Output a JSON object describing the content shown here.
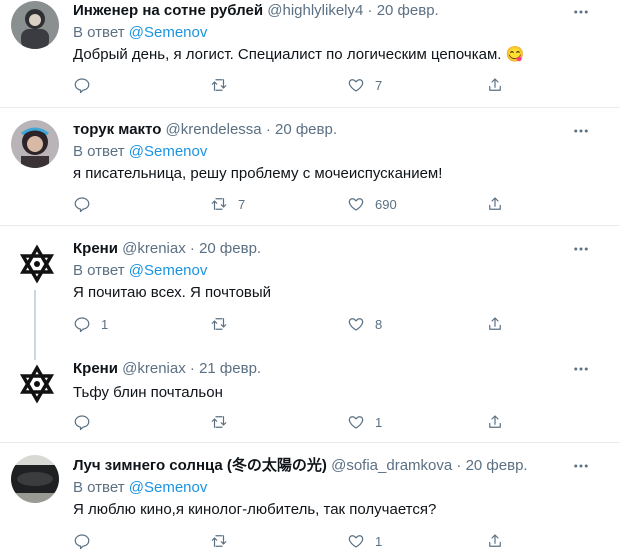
{
  "tweets": [
    {
      "name": "Инженер на сотне рублей",
      "handle": "@highlylikely4",
      "date": "20 февр.",
      "reply_prefix": "В ответ",
      "reply_to": "@Semenov",
      "text": "Добрый день, я логист. Специалист по логическим цепочкам. 😋",
      "reply_count": "",
      "retweet_count": "",
      "like_count": "7"
    },
    {
      "name": "торук макто",
      "handle": "@krendelessa",
      "date": "20 февр.",
      "reply_prefix": "В ответ",
      "reply_to": "@Semenov",
      "text": "я писательница, решу проблему с мочеиспусканием!",
      "reply_count": "",
      "retweet_count": "7",
      "like_count": "690"
    },
    {
      "name": "Крени",
      "handle": "@kreniax",
      "date": "20 февр.",
      "reply_prefix": "В ответ",
      "reply_to": "@Semenov",
      "text": "Я почитаю всех. Я почтовый",
      "reply_count": "1",
      "retweet_count": "",
      "like_count": "8"
    },
    {
      "name": "Крени",
      "handle": "@kreniax",
      "date": "21 февр.",
      "text": "Тьфу блин почтальон",
      "reply_count": "",
      "retweet_count": "",
      "like_count": "1"
    },
    {
      "name": "Луч зимнего солнца (冬の太陽の光)",
      "handle": "@sofia_dramkova",
      "date": "20 февр.",
      "reply_prefix": "В ответ",
      "reply_to": "@Semenov",
      "text": "Я люблю кино,я кинолог-любитель, так получается?",
      "reply_count": "",
      "retweet_count": "",
      "like_count": "1"
    }
  ],
  "separator": "·",
  "icons": [
    "reply-icon",
    "retweet-icon",
    "like-icon",
    "share-icon",
    "more-icon"
  ],
  "colors": {
    "mention": "#1b95e0",
    "secondary_text": "#5b7083",
    "divider": "#e6ecf0"
  }
}
